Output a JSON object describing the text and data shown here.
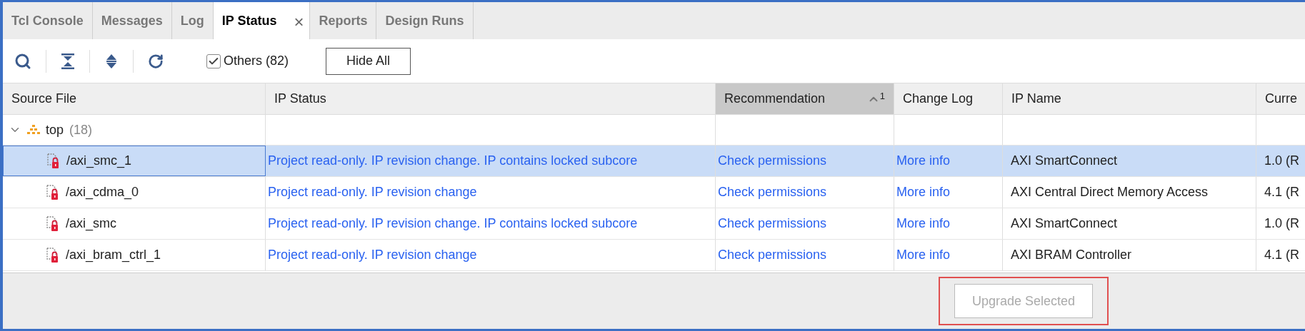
{
  "tabs": [
    {
      "label": "Tcl Console",
      "selected": false
    },
    {
      "label": "Messages",
      "selected": false
    },
    {
      "label": "Log",
      "selected": false
    },
    {
      "label": "IP Status",
      "selected": true,
      "close": "×"
    },
    {
      "label": "Reports",
      "selected": false
    },
    {
      "label": "Design Runs",
      "selected": false
    }
  ],
  "toolbar": {
    "filter": {
      "label": "Others (82)",
      "checked": true
    },
    "button": "Hide All"
  },
  "table": {
    "columns": [
      {
        "label": "Source File",
        "sorted": false
      },
      {
        "label": "IP Status",
        "sorted": false
      },
      {
        "label": "Recommendation",
        "sorted": true,
        "sort_rank": "1"
      },
      {
        "label": "Change Log",
        "sorted": false
      },
      {
        "label": "IP Name",
        "sorted": false
      },
      {
        "label": "Curre",
        "sorted": false
      }
    ],
    "groups": [
      {
        "name": "top",
        "count": "(18)",
        "expanded": true,
        "children": [
          {
            "source": "/axi_smc_1",
            "status": "Project read-only. IP revision change. IP contains locked subcore",
            "recommendation": "Check permissions",
            "change_log": "More info",
            "ip_name": "AXI SmartConnect",
            "current": "1.0 (R",
            "selected": true
          },
          {
            "source": "/axi_cdma_0",
            "status": "Project read-only. IP revision change",
            "recommendation": "Check permissions",
            "change_log": "More info",
            "ip_name": "AXI Central Direct Memory Access",
            "current": "4.1 (R",
            "selected": false
          },
          {
            "source": "/axi_smc",
            "status": "Project read-only. IP revision change. IP contains locked subcore",
            "recommendation": "Check permissions",
            "change_log": "More info",
            "ip_name": "AXI SmartConnect",
            "current": "1.0 (R",
            "selected": false
          },
          {
            "source": "/axi_bram_ctrl_1",
            "status": "Project read-only. IP revision change",
            "recommendation": "Check permissions",
            "change_log": "More info",
            "ip_name": "AXI BRAM Controller",
            "current": "4.1 (R",
            "selected": false
          }
        ]
      }
    ]
  },
  "footer": {
    "button": {
      "label": "Upgrade Selected",
      "disabled": true,
      "highlighted": true
    }
  }
}
